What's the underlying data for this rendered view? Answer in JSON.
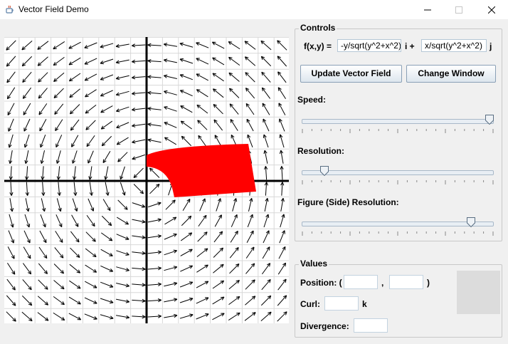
{
  "window": {
    "title": "Vector Field Demo",
    "icons": {
      "app": "java-coffee-icon",
      "minimize": "minimize-icon",
      "maximize": "maximize-icon",
      "close": "close-icon"
    },
    "maximize_enabled": false
  },
  "plot": {
    "field_fx": "-y/sqrt(y^2+x^2)",
    "field_fy": "x/sqrt(y^2+x^2)",
    "figure_color": "#ff0000"
  },
  "controls": {
    "title": "Controls",
    "function_label": "f(x,y) =",
    "fx_value": "-y/sqrt(y^2+x^2)",
    "i_label": "i +",
    "fy_value": "x/sqrt(y^2+x^2)",
    "j_label": "j",
    "update_button": "Update Vector Field",
    "change_window_button": "Change Window",
    "speed_label": "Speed:",
    "speed_value": 1.0,
    "resolution_label": "Resolution:",
    "resolution_value": 0.1,
    "figure_resolution_label": "Figure (Side) Resolution:",
    "figure_resolution_value": 0.9
  },
  "values": {
    "title": "Values",
    "position_label": "Position: (",
    "comma": ",",
    "close_paren": ")",
    "position_x": "",
    "position_y": "",
    "curl_label": "Curl:",
    "curl_value": "",
    "k_label": "k",
    "divergence_label": "Divergence:",
    "divergence_value": "",
    "swatch_color": "#dcdcdc"
  }
}
